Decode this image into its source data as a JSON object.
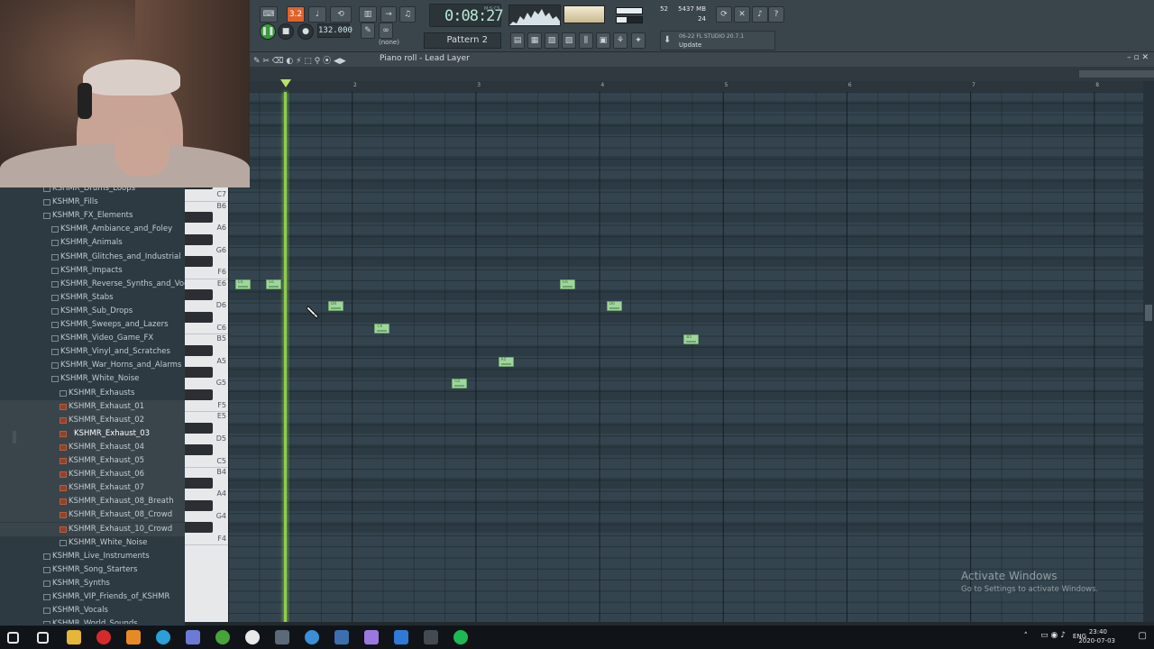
{
  "toolbar": {
    "time": "0:08:27",
    "time_unit": "M:S:CS",
    "tempo": "132.000",
    "pattern": "Pattern 2",
    "pattern_none": "(none)",
    "cpu_value": "52",
    "ram_value": "5437 MB",
    "polyphony": "24",
    "news_line1": "06-22  FL STUDIO 20.7.1",
    "news_line2": "Update",
    "snap_label": "3.2",
    "help_label": "?"
  },
  "piano_roll": {
    "title": "Piano roll - Lead Layer",
    "ruler_bars": [
      "2",
      "3",
      "4",
      "5",
      "6",
      "7",
      "8"
    ],
    "key_labels": [
      "C7",
      "B6",
      "A6",
      "G6",
      "F6",
      "E6",
      "D6",
      "C6",
      "B5",
      "A5",
      "G5",
      "F5",
      "E5",
      "D5",
      "C5",
      "B4",
      "A4",
      "G4",
      "F4"
    ],
    "notes": [
      {
        "label": "E6",
        "beat": 0.0,
        "pitch": "E6"
      },
      {
        "label": "E6",
        "beat": 0.25,
        "pitch": "E6"
      },
      {
        "label": "D6",
        "beat": 0.75,
        "pitch": "D6"
      },
      {
        "label": "C6",
        "beat": 1.125,
        "pitch": "C6"
      },
      {
        "label": "G5",
        "beat": 1.75,
        "pitch": "G5"
      },
      {
        "label": "A5",
        "beat": 2.125,
        "pitch": "A5"
      },
      {
        "label": "E6",
        "beat": 2.625,
        "pitch": "E6"
      },
      {
        "label": "D6",
        "beat": 3.0,
        "pitch": "D6"
      },
      {
        "label": "B5",
        "beat": 3.625,
        "pitch": "B5"
      }
    ]
  },
  "browser": {
    "items": [
      {
        "label": "KSHMR_Drums_Loops",
        "level": 1,
        "kind": "folder"
      },
      {
        "label": "KSHMR_Fills",
        "level": 1,
        "kind": "folder"
      },
      {
        "label": "KSHMR_FX_Elements",
        "level": 1,
        "kind": "folder-open"
      },
      {
        "label": "KSHMR_Ambiance_and_Foley",
        "level": 2,
        "kind": "folder"
      },
      {
        "label": "KSHMR_Animals",
        "level": 2,
        "kind": "folder"
      },
      {
        "label": "KSHMR_Glitches_and_Industrial",
        "level": 2,
        "kind": "folder"
      },
      {
        "label": "KSHMR_Impacts",
        "level": 2,
        "kind": "folder"
      },
      {
        "label": "KSHMR_Reverse_Synths_and_Vocals",
        "level": 2,
        "kind": "folder"
      },
      {
        "label": "KSHMR_Stabs",
        "level": 2,
        "kind": "folder"
      },
      {
        "label": "KSHMR_Sub_Drops",
        "level": 2,
        "kind": "folder"
      },
      {
        "label": "KSHMR_Sweeps_and_Lazers",
        "level": 2,
        "kind": "folder"
      },
      {
        "label": "KSHMR_Video_Game_FX",
        "level": 2,
        "kind": "folder"
      },
      {
        "label": "KSHMR_Vinyl_and_Scratches",
        "level": 2,
        "kind": "folder"
      },
      {
        "label": "KSHMR_War_Horns_and_Alarms",
        "level": 2,
        "kind": "folder"
      },
      {
        "label": "KSHMR_White_Noise",
        "level": 2,
        "kind": "folder-open"
      },
      {
        "label": "KSHMR_Exhausts",
        "level": 3,
        "kind": "folder-open"
      },
      {
        "label": "KSHMR_Exhaust_01",
        "level": 4,
        "kind": "file"
      },
      {
        "label": "KSHMR_Exhaust_02",
        "level": 4,
        "kind": "file"
      },
      {
        "label": "KSHMR_Exhaust_03",
        "level": 4,
        "kind": "file",
        "selected": true
      },
      {
        "label": "KSHMR_Exhaust_04",
        "level": 4,
        "kind": "file"
      },
      {
        "label": "KSHMR_Exhaust_05",
        "level": 4,
        "kind": "file"
      },
      {
        "label": "KSHMR_Exhaust_06",
        "level": 4,
        "kind": "file"
      },
      {
        "label": "KSHMR_Exhaust_07",
        "level": 4,
        "kind": "file"
      },
      {
        "label": "KSHMR_Exhaust_08_Breath",
        "level": 4,
        "kind": "file"
      },
      {
        "label": "KSHMR_Exhaust_08_Crowd",
        "level": 4,
        "kind": "file"
      },
      {
        "label": "KSHMR_Exhaust_10_Crowd",
        "level": 4,
        "kind": "file"
      },
      {
        "label": "KSHMR_White_Noise",
        "level": 3,
        "kind": "folder"
      },
      {
        "label": "KSHMR_Live_Instruments",
        "level": 1,
        "kind": "folder"
      },
      {
        "label": "KSHMR_Song_Starters",
        "level": 1,
        "kind": "folder"
      },
      {
        "label": "KSHMR_Synths",
        "level": 1,
        "kind": "folder"
      },
      {
        "label": "KSHMR_VIP_Friends_of_KSHMR",
        "level": 1,
        "kind": "folder"
      },
      {
        "label": "KSHMR_Vocals",
        "level": 1,
        "kind": "folder"
      },
      {
        "label": "KSHMR_World_Sounds",
        "level": 1,
        "kind": "folder"
      }
    ]
  },
  "watermark": {
    "title": "Activate Windows",
    "subtitle": "Go to Settings to activate Windows."
  },
  "taskbar": {
    "lang": "ENG",
    "time": "23:40",
    "date": "2020-07-03",
    "apps": [
      "start",
      "search",
      "explorer",
      "opera",
      "fl-studio",
      "telegram",
      "discord",
      "utorrent",
      "chrome",
      "steam",
      "visual-studio",
      "game-app",
      "after-effects",
      "photoshop",
      "obs",
      "spotify"
    ]
  },
  "colors": {
    "note": "#9fd69c",
    "playhead": "#8dcf4a",
    "accent": "#e0622b",
    "grid": "#34444e"
  }
}
